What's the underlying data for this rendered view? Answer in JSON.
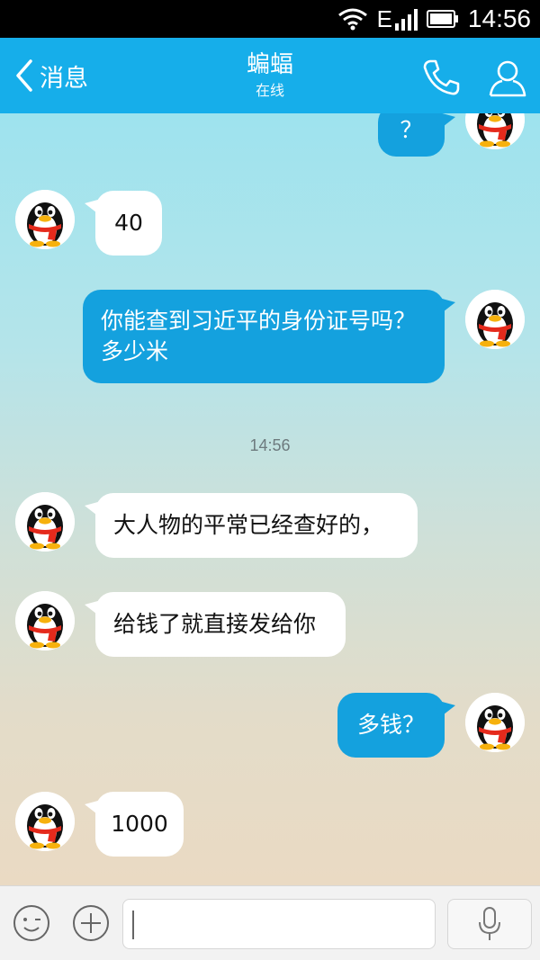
{
  "status_bar": {
    "network": "E",
    "time": "14:56"
  },
  "header": {
    "back_label": "消息",
    "contact_name": "蝙蝠",
    "contact_status": "在线"
  },
  "messages": [
    {
      "side": "out",
      "text": "？"
    },
    {
      "side": "in",
      "text": "40"
    },
    {
      "side": "out",
      "text": "你能查到习近平的身份证号吗？ 多少米"
    },
    {
      "side": "in",
      "text": "大人物的平常已经查好的，"
    },
    {
      "side": "in",
      "text": "给钱了就直接发给你"
    },
    {
      "side": "out",
      "text": "多钱？"
    },
    {
      "side": "in",
      "text": "1000"
    }
  ],
  "timestamp": "14:56",
  "input": {
    "placeholder": ""
  },
  "colors": {
    "header_bg": "#16aeea",
    "outgoing_bubble": "#14a1de",
    "incoming_bubble": "#ffffff"
  },
  "icons": {
    "back": "chevron-left-icon",
    "call": "phone-icon",
    "profile": "user-icon",
    "emoji": "smiley-icon",
    "plus": "plus-icon",
    "voice": "microphone-icon",
    "avatar": "qq-penguin-icon"
  }
}
